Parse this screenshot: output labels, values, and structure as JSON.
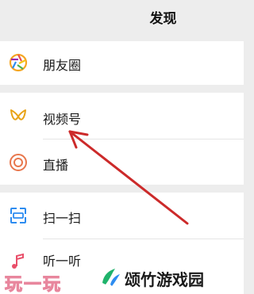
{
  "header": {
    "title": "发现"
  },
  "menu": {
    "moments": {
      "label": "朋友圈",
      "icon": "moments-aperture-icon"
    },
    "channels": {
      "label": "视频号",
      "icon": "channels-icon"
    },
    "live": {
      "label": "直播",
      "icon": "live-icon"
    },
    "scan": {
      "label": "扫一扫",
      "icon": "scan-icon"
    },
    "listen": {
      "label": "听一听",
      "icon": "music-note-icon"
    }
  },
  "watermark": {
    "left": "玩一玩",
    "right": "颂竹游戏园"
  },
  "colors": {
    "arrow": "#cc2a2a",
    "channels_icon": "#e8a317",
    "live_icon": "#e8774d",
    "scan_icon": "#2d8cf0"
  }
}
